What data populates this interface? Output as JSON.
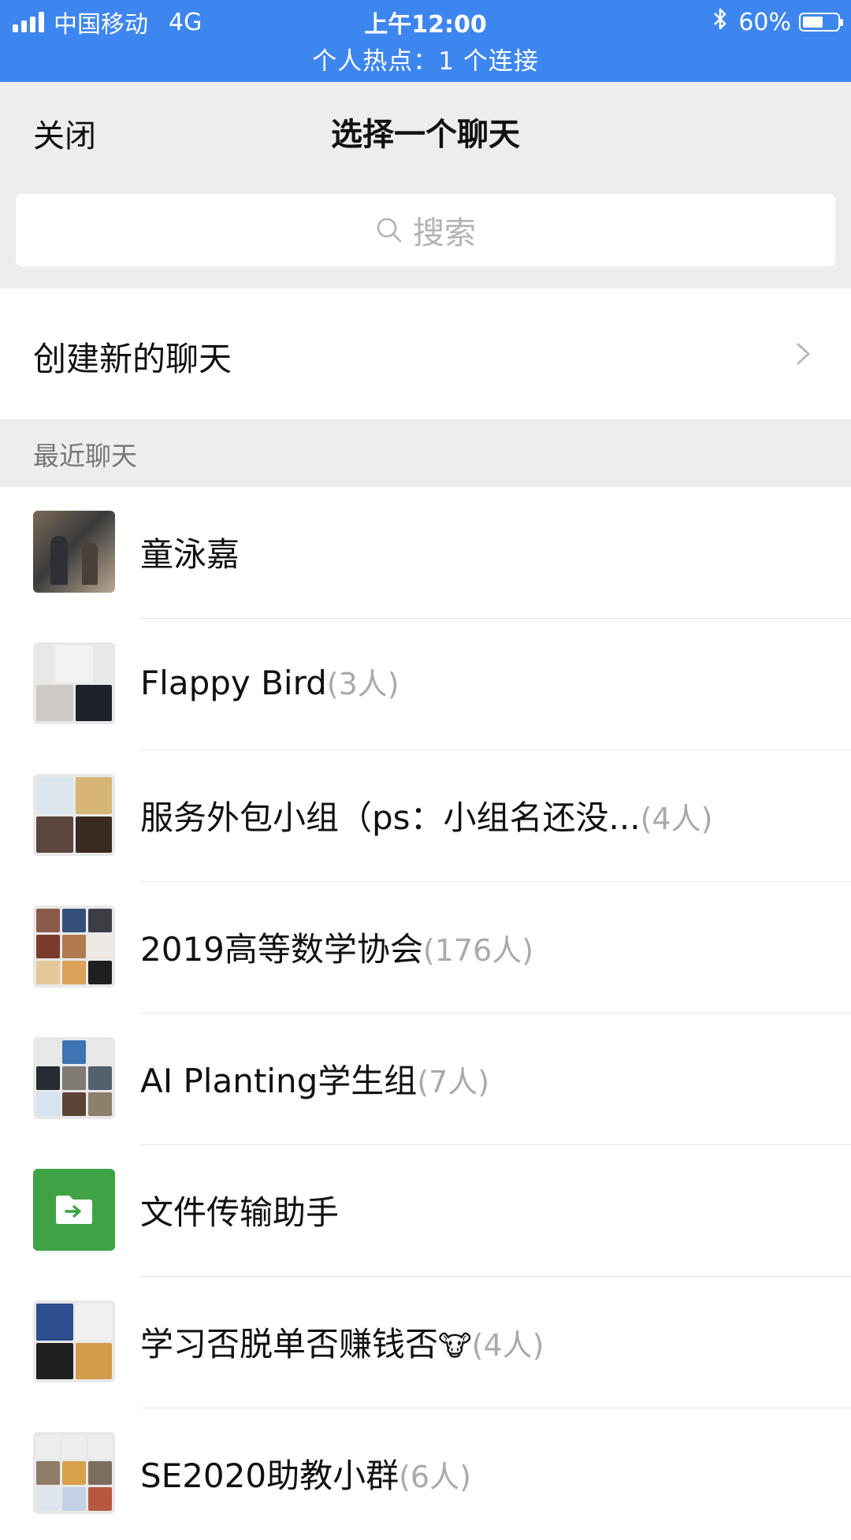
{
  "status_bar": {
    "carrier": "中国移动",
    "network": "4G",
    "time": "上午12:00",
    "battery": "60%",
    "battery_level": 0.6,
    "hotspot": "个人热点：1 个连接",
    "bluetooth_icon": "bluetooth-icon"
  },
  "nav": {
    "close": "关闭",
    "title": "选择一个聊天"
  },
  "search": {
    "placeholder": "搜索",
    "icon": "search-icon"
  },
  "new_chat": {
    "label": "创建新的聊天",
    "icon": "chevron-right-icon"
  },
  "recent": {
    "header": "最近聊天"
  },
  "chats": [
    {
      "name": "童泳嘉",
      "count": ""
    },
    {
      "name": "Flappy Bird",
      "count": "(3人)"
    },
    {
      "name": "服务外包小组（ps：小组名还没...",
      "count": "(4人)"
    },
    {
      "name": "2019高等数学协会",
      "count": "(176人)"
    },
    {
      "name": "AI Planting学生组",
      "count": "(7人)"
    },
    {
      "name": "文件传输助手",
      "count": ""
    },
    {
      "name": "学习否脱单否赚钱否",
      "emoji": "🐮",
      "count": "(4人)"
    },
    {
      "name": "SE2020助教小群",
      "count": "(6人)"
    }
  ],
  "colors": {
    "status_bar": "#3e86ef",
    "nav_bg": "#ededed",
    "file_helper": "#3fa345"
  }
}
